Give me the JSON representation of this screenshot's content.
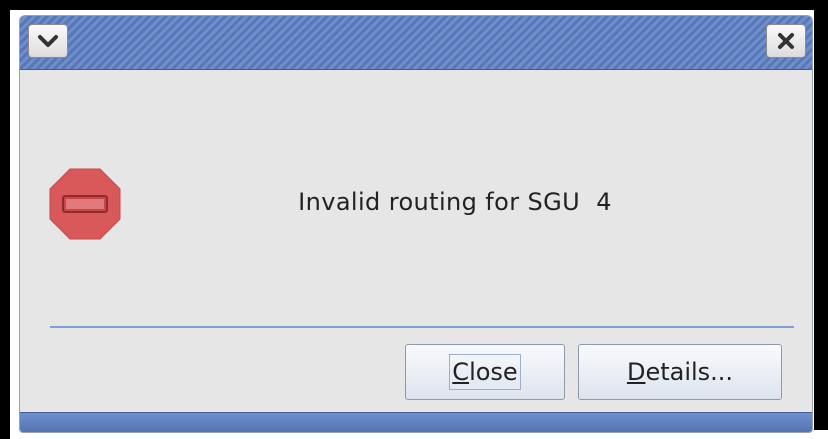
{
  "window": {
    "menu_button_icon": "chevron-down-icon",
    "close_button_icon": "close-icon",
    "titlebar_color": "#5777b8"
  },
  "dialog": {
    "icon": "stop-error-icon",
    "icon_color": "#d9595b",
    "message": "Invalid routing for SGU  4"
  },
  "buttons": {
    "close": {
      "mnemonic": "C",
      "rest": "lose"
    },
    "details": {
      "mnemonic": "D",
      "rest": "etails..."
    }
  }
}
